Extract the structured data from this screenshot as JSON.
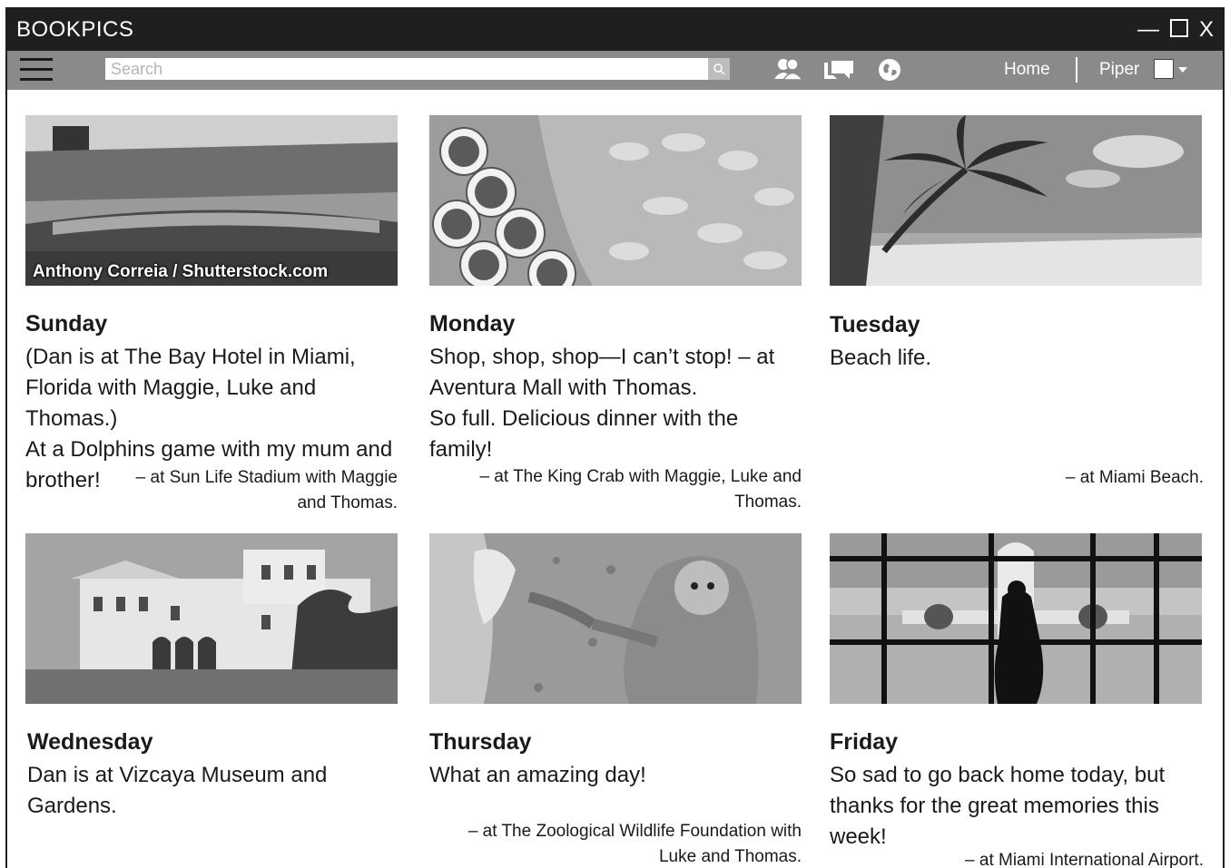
{
  "app": {
    "title": "BOOKPICS"
  },
  "window_controls": {
    "minimize": "—",
    "close": "X"
  },
  "toolbar": {
    "search_placeholder": "Search",
    "nav": {
      "home": "Home",
      "user": "Piper"
    }
  },
  "icons": [
    "menu-icon",
    "search-icon",
    "friends-icon",
    "messages-icon",
    "globe-icon",
    "chevron-down-icon"
  ],
  "posts": [
    {
      "day": "Sunday",
      "lines": [
        "(Dan is at The Bay Hotel in Miami,",
        "Florida with Maggie, Luke and Thomas.)",
        "At a Dolphins game with my mum and",
        "brother!"
      ],
      "location_lines": [
        "– at Sun Life Stadium with Maggie",
        "and Thomas."
      ],
      "photo": "stadium",
      "credit": "Anthony Correia / Shutterstock.com"
    },
    {
      "day": "Monday",
      "lines": [
        "Shop, shop, shop—I can’t stop! – at",
        "Aventura Mall with Thomas.",
        "So full. Delicious dinner with the family!"
      ],
      "location_lines": [
        "– at The King Crab with Maggie, Luke and",
        "Thomas."
      ],
      "photo": "seafood"
    },
    {
      "day": "Tuesday",
      "lines": [
        "Beach life."
      ],
      "location_lines": [
        "– at Miami Beach."
      ],
      "photo": "beach"
    },
    {
      "day": "Wednesday",
      "lines": [
        "Dan is at Vizcaya Museum and",
        "Gardens."
      ],
      "location_lines": [],
      "photo": "museum"
    },
    {
      "day": "Thursday",
      "lines": [
        "What an amazing day!"
      ],
      "location_lines": [
        "– at The Zoological Wildlife Foundation with",
        "Luke and Thomas."
      ],
      "photo": "monkey"
    },
    {
      "day": "Friday",
      "lines": [
        "So sad to go back home today, but",
        "thanks for the great memories this",
        "week!"
      ],
      "location_lines": [
        "– at Miami International Airport."
      ],
      "photo": "airport"
    }
  ]
}
